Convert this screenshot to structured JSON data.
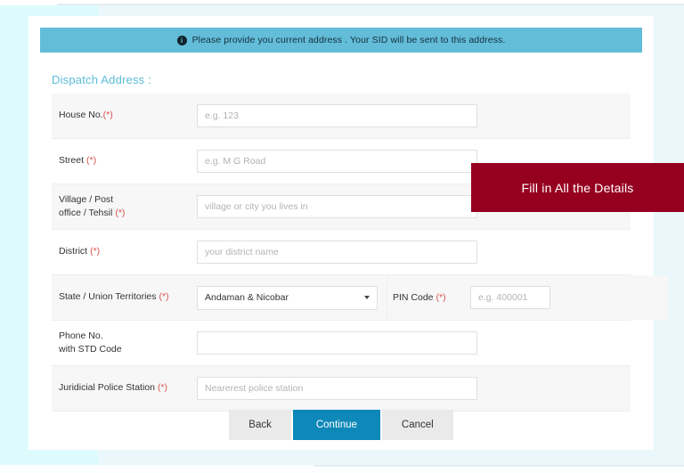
{
  "banner": {
    "icon": "info-circle-icon",
    "text": "Please provide you current address . Your SID will be sent to this address."
  },
  "section": {
    "title": "Dispatch Address :"
  },
  "form": {
    "rows": [
      {
        "label": "House No.",
        "required_marker": "(*)",
        "tight_marker": true,
        "placeholder": "e.g. 123",
        "value": ""
      },
      {
        "label": "Street",
        "required_marker": "(*)",
        "tight_marker": false,
        "placeholder": "e.g. M G Road",
        "value": ""
      },
      {
        "label_line1": "Village / Post",
        "label_line2": "office / Tehsil",
        "required_marker": "(*)",
        "placeholder": "village or city you lives in",
        "value": ""
      },
      {
        "label": "District",
        "required_marker": "(*)",
        "tight_marker": false,
        "placeholder": "your district name",
        "value": ""
      },
      {
        "label": "State / Union Territories",
        "required_marker": "(*)",
        "selected_option": "Andaman & Nicobar",
        "second_label": "PIN Code",
        "second_required_marker": "(*)",
        "second_placeholder": "e.g. 400001",
        "second_value": ""
      },
      {
        "label_line1": "Phone No.",
        "label_line2": "with STD Code",
        "required_marker": "",
        "placeholder": "",
        "value": ""
      },
      {
        "label": "Juridicial Police Station",
        "required_marker": "(*)",
        "tight_marker": false,
        "placeholder": "Nearerest police station",
        "value": ""
      }
    ]
  },
  "buttons": {
    "back": "Back",
    "continue": "Continue",
    "cancel": "Cancel"
  },
  "callout": {
    "text": "Fill in All the Details"
  },
  "colors": {
    "banner_bg": "#63bcd8",
    "section_title": "#5bbcd8",
    "primary_button": "#0e88b8",
    "callout_bg": "#960020",
    "required_marker": "#d9534f",
    "page_bg": "#ddfbfd"
  }
}
